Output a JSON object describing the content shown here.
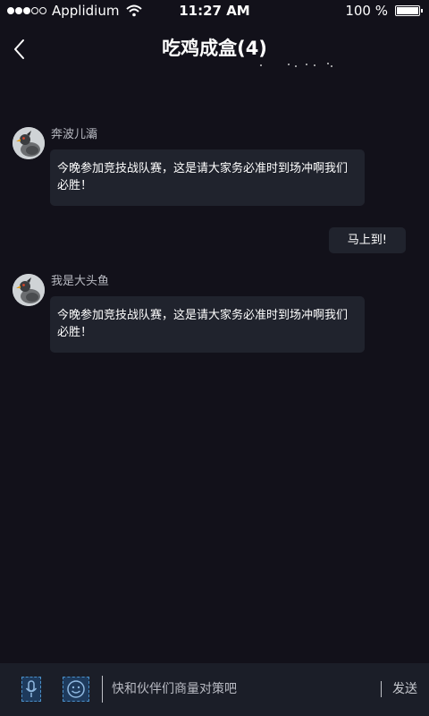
{
  "status_bar": {
    "carrier": "Applidium",
    "time": "11:27 AM",
    "battery_percent": "100 %",
    "signal_bars_filled": 3,
    "signal_bars_total": 5
  },
  "nav": {
    "title": "吃鸡成盒(4)"
  },
  "messages": [
    {
      "sender": "奔波儿灞",
      "text": "今晚参加竞技战队赛，这是请大家务必准时到场冲啊我们必胜！"
    },
    {
      "sender": "我是大头鱼",
      "text": "今晚参加竞技战队赛，这是请大家务必准时到场冲啊我们必胜！"
    }
  ],
  "self_message": {
    "text": "马上到!"
  },
  "input_bar": {
    "placeholder": "快和伙伴们商量对策吧",
    "send_label": "发送"
  },
  "colors": {
    "background": "#12111a",
    "bubble": "#20232d",
    "input_bar": "#1b1e28",
    "icon_accent": "#4a90c9"
  },
  "icons": [
    "back-chevron",
    "microphone",
    "emoji-face",
    "wifi",
    "battery"
  ]
}
